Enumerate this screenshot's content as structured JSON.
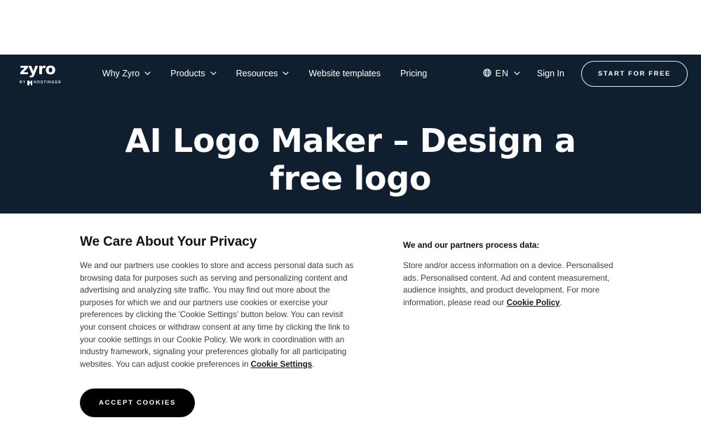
{
  "brand": {
    "logo_word": "zyro",
    "logo_by": "BY",
    "logo_parent": "HOSTINGER"
  },
  "nav": {
    "items": [
      {
        "label": "Why Zyro",
        "has_chevron": true
      },
      {
        "label": "Products",
        "has_chevron": true
      },
      {
        "label": "Resources",
        "has_chevron": true
      },
      {
        "label": "Website templates",
        "has_chevron": false
      },
      {
        "label": "Pricing",
        "has_chevron": false
      }
    ],
    "language_code": "EN",
    "signin_label": "Sign In",
    "cta_label": "START FOR FREE"
  },
  "hero": {
    "heading": "AI Logo Maker – Design a free logo",
    "background_color": "#0f1f2f",
    "text_color": "#ffffff"
  },
  "consent": {
    "title": "We Care About Your Privacy",
    "body_part_1": "We and our partners use cookies to store and access personal data such as browsing data for purposes such as serving and personalizing content and advertising and analyzing site traffic. You may find out more about the purposes for which we and our partners use cookies or exercise your preferences by clicking the 'Cookie Settings' button below. You can revisit your consent choices or withdraw consent at any time by clicking the link to your cookie settings in our Cookie Policy. We work in coordination with an industry framework, signaling your preferences globally for all participating websites. You can adjust cookie preferences in ",
    "body_link_1": "Cookie Settings",
    "body_part_1_end": ".",
    "accept_label": "ACCEPT COOKIES",
    "partners_title": "We and our partners process data:",
    "partners_body_start": "Store and/or access information on a device. Personalised ads. Personalised content. Ad and content measurement, audience insights, and product development. For more information, please read our ",
    "partners_link": "Cookie Policy",
    "partners_body_end": ".",
    "accent_color": "#000000"
  }
}
